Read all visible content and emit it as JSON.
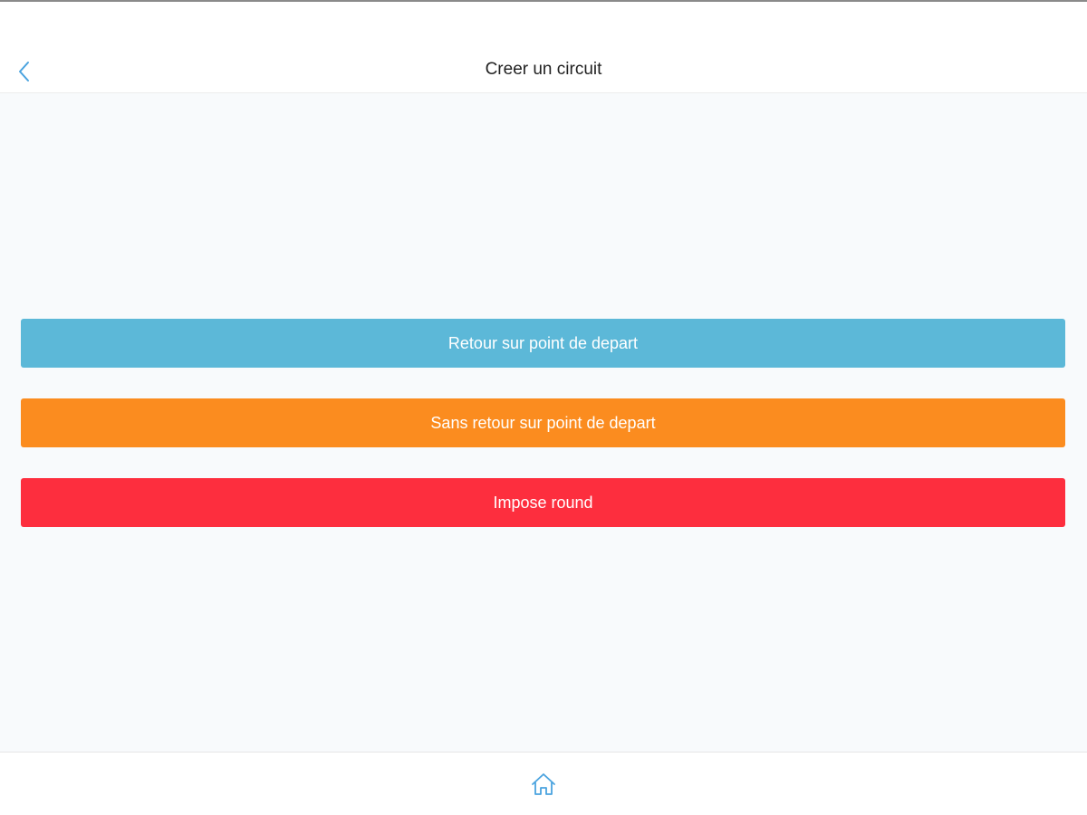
{
  "header": {
    "title": "Creer un circuit",
    "back_icon": "chevron-left-icon"
  },
  "actions": {
    "return_to_start": {
      "label": "Retour sur point de depart",
      "color": "#5cb8d8"
    },
    "no_return_to_start": {
      "label": "Sans retour sur point de depart",
      "color": "#fb8c1f"
    },
    "imposed_round": {
      "label": "Impose round",
      "color": "#fd2e3e"
    }
  },
  "tab_bar": {
    "home_icon": "home-icon"
  },
  "colors": {
    "accent": "#4aa3df",
    "background": "#f8fafc",
    "bar_background": "#ffffff"
  }
}
